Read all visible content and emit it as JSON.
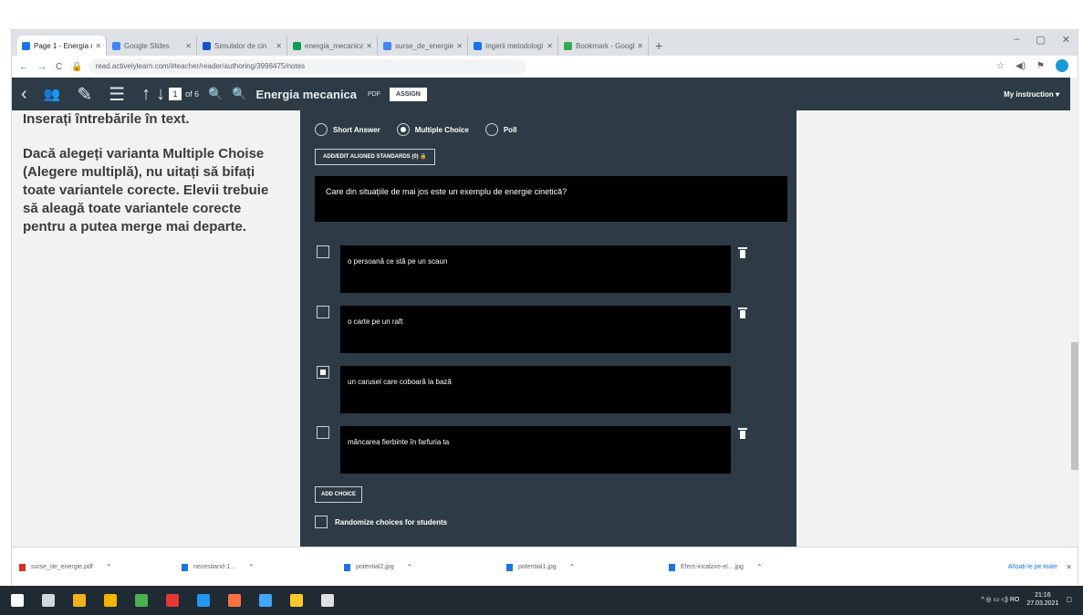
{
  "browser": {
    "tabs": [
      {
        "label": "Page 1 - Energia meca",
        "color": "#1a73e8",
        "active": true
      },
      {
        "label": "Google Slides",
        "color": "#4285f4",
        "active": false
      },
      {
        "label": "Simulator de cin",
        "color": "#1155cc",
        "active": false
      },
      {
        "label": "energia_mecanica",
        "color": "#0f9d58",
        "active": false
      },
      {
        "label": "surse_de_energie",
        "color": "#4285f4",
        "active": false
      },
      {
        "label": "Ingerii metodologi",
        "color": "#1a73e8",
        "active": false
      },
      {
        "label": "Bookmark - Google Sea",
        "color": "#34a853",
        "active": false
      }
    ],
    "new_tab": "+",
    "window_controls": [
      "–",
      "▢",
      "✕"
    ],
    "nav": [
      "←",
      "→",
      "C"
    ],
    "url": "read.activelylearn.com/#teacher/reader/authoring/3998475/notes",
    "right_icons": [
      "☆",
      "◀)",
      "⚑"
    ]
  },
  "app_toolbar": {
    "icons": [
      "chevron-left-icon",
      "users-icon",
      "edit-icon",
      "notes-icon",
      "arrow-up-icon",
      "arrow-down-icon"
    ],
    "icon_glyphs": [
      "‹",
      "👥",
      "✎",
      "☰",
      "↑",
      "↓"
    ],
    "page_current": "1",
    "page_of": "of 6",
    "zoom_out": "🔍",
    "zoom_in": "🔍",
    "title": "Energia mecanica",
    "pdf_label": "PDF",
    "assign_label": "ASSIGN",
    "my_instruction": "My instruction ▾"
  },
  "left_note": {
    "p1": "Inserați întrebările în text.",
    "p2": "Dacă alegeți varianta Multiple Choise (Alegere multiplă), nu uitați să bifați toate variantele corecte. Elevii trebuie să aleagă toate variantele corecte pentru a putea merge mai departe."
  },
  "question_editor": {
    "type_options": [
      {
        "label": "Short Answer",
        "selected": false
      },
      {
        "label": "Multiple Choice",
        "selected": true
      },
      {
        "label": "Poll",
        "selected": false
      }
    ],
    "standards_button": "ADD/EDIT ALIGNED STANDARDS (0) 🔒",
    "question_text": "Care din situațiile de mai jos este un exemplu de energie cinetică?",
    "choices": [
      {
        "text": "o persoană ce stă pe un scaun",
        "checked": false,
        "deletable": true
      },
      {
        "text": "o carte pe un raft",
        "checked": false,
        "deletable": true
      },
      {
        "text": "un carusel care coboară la bază",
        "checked": true,
        "deletable": false
      },
      {
        "text": "mâncarea fierbinte în farfuria ta",
        "checked": false,
        "deletable": true
      }
    ],
    "add_choice": "ADD CHOICE",
    "randomize_label": "Randomize choices for students"
  },
  "download_shelf": {
    "items": [
      {
        "name": "surse_de_energie.pdf",
        "color": "#d93025"
      },
      {
        "name": "necesitand-1...",
        "color": "#1a73e8"
      },
      {
        "name": "potential2.jpg",
        "color": "#1a73e8"
      },
      {
        "name": "potential1.jpg",
        "color": "#1a73e8"
      },
      {
        "name": "Efect-incalzire-el....jpg",
        "color": "#1a73e8"
      }
    ],
    "chevron": "⌃",
    "show_all": "Afișați-le pe toate",
    "close": "✕"
  },
  "taskbar": {
    "apps": [
      {
        "name": "windows-icon",
        "color": "#ffffff"
      },
      {
        "name": "search-icon",
        "color": "#cfd8dc"
      },
      {
        "name": "file-explorer-icon",
        "color": "#f2b01e"
      },
      {
        "name": "chrome-icon",
        "color": "#f4b400"
      },
      {
        "name": "files-icon",
        "color": "#4caf50"
      },
      {
        "name": "opera-icon",
        "color": "#e53935"
      },
      {
        "name": "photoshop-icon",
        "color": "#2196f3"
      },
      {
        "name": "chrome-active-icon",
        "color": "#ff7043"
      },
      {
        "name": "edge-icon",
        "color": "#42a5f5"
      },
      {
        "name": "folder-icon",
        "color": "#ffca28"
      },
      {
        "name": "paint-icon",
        "color": "#e0e0e0"
      }
    ],
    "tray": "^ ◎ ▭ ◁) RO",
    "time": "21:16",
    "date": "27.03.2021",
    "notification": "▢"
  }
}
